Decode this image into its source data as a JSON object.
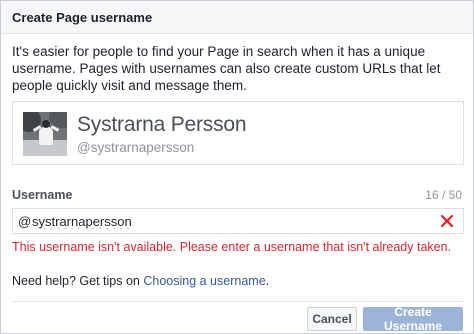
{
  "dialog": {
    "title": "Create Page username",
    "description": "It's easier for people to find your Page in search when it has a unique username. Pages with usernames can also create custom URLs that let people quickly visit and message them."
  },
  "preview": {
    "page_name": "Systrarna Persson",
    "handle": "@systrarnapersson"
  },
  "field": {
    "label": "Username",
    "char_count": "16 / 50",
    "prefix": "@",
    "value": "systrarnapersson",
    "error": "This username isn't available. Please enter a username that isn't already taken."
  },
  "help": {
    "prefix": "Need help? Get tips on ",
    "link": "Choosing a username",
    "suffix": "."
  },
  "buttons": {
    "cancel": "Cancel",
    "create": "Create Username"
  },
  "colors": {
    "error": "#d9262e",
    "link": "#365899",
    "primary_disabled": "#9cb4d8"
  }
}
